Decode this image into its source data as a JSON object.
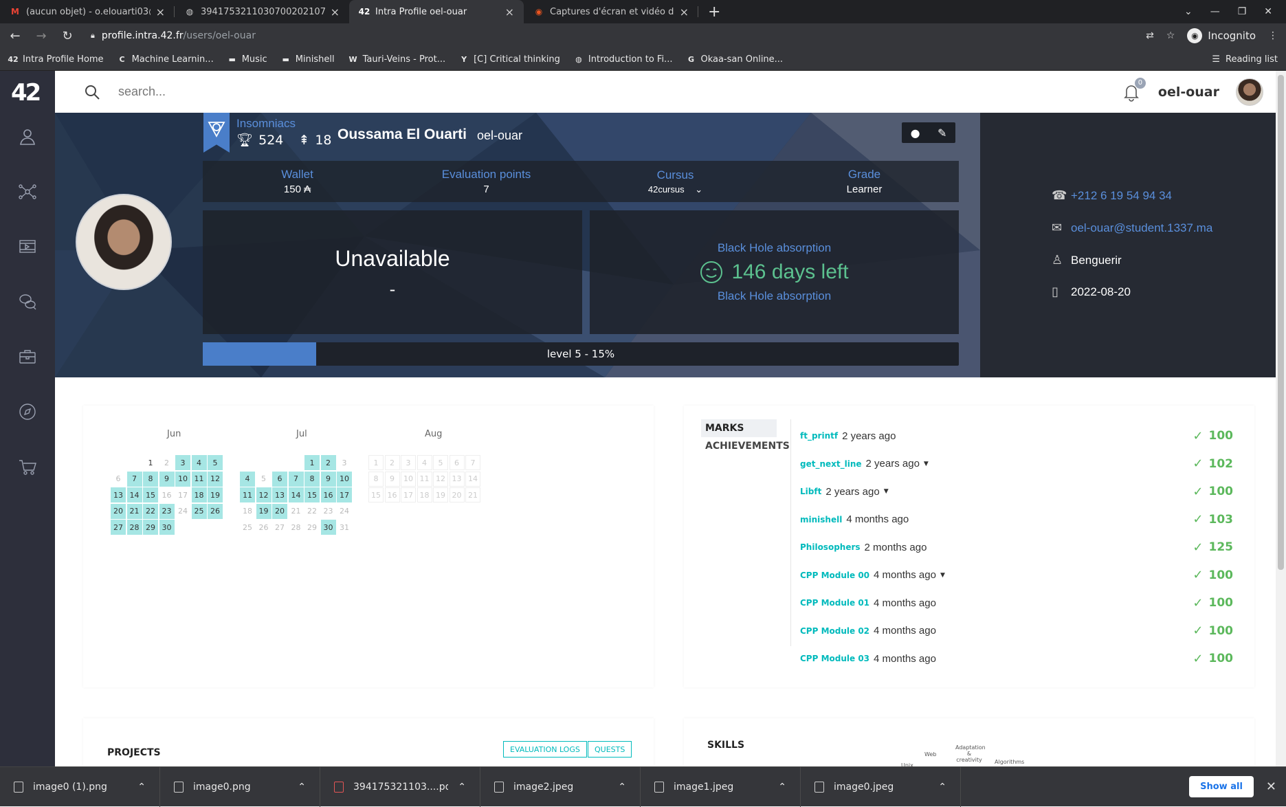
{
  "browser": {
    "tabs": [
      {
        "title": "(aucun objet) - o.elouarti03@...",
        "icon": "gmail-icon",
        "color": "#ea4335"
      },
      {
        "title": "39417532110307002021​07.pdf",
        "icon": "globe-icon",
        "color": "#ccc"
      },
      {
        "title": "Intra Profile oel-ouar",
        "icon": "42-icon",
        "color": "#fff"
      },
      {
        "title": "Captures d'écran et vidéo d'é...",
        "icon": "ubuntu-icon",
        "color": "#e95420"
      }
    ],
    "url_host": "profile.intra.42.fr",
    "url_path": "/users/oel-ouar",
    "incognito_label": "Incognito",
    "bookmarks": [
      {
        "label": "Intra Profile Home",
        "icon": "42-icon"
      },
      {
        "label": "Machine Learnin...",
        "icon": "coursera-icon"
      },
      {
        "label": "Music",
        "icon": "folder-icon"
      },
      {
        "label": "Minishell",
        "icon": "folder-icon"
      },
      {
        "label": "Tauri-Veins - Prot...",
        "icon": "w-icon"
      },
      {
        "label": "[C] Critical thinking",
        "icon": "y-icon"
      },
      {
        "label": "Introduction to Fi...",
        "icon": "globe-icon"
      },
      {
        "label": "Okaa-san Online...",
        "icon": "google-icon"
      }
    ],
    "reading_list": "Reading list"
  },
  "topbar": {
    "search_placeholder": "search...",
    "notification_count": "0",
    "username": "oel-ouar"
  },
  "profile": {
    "coalition": "Insomniacs",
    "trophies": "524",
    "rank_points": "18",
    "full_name": "Oussama El Ouarti",
    "login": "oel-ouar",
    "wallet_label": "Wallet",
    "wallet_value": "150 ₳",
    "eval_label": "Evaluation points",
    "eval_value": "7",
    "cursus_label": "Cursus",
    "cursus_value": "42cursus",
    "grade_label": "Grade",
    "grade_value": "Learner",
    "location_status": "Unavailable",
    "location_detail": "-",
    "blackhole_label": "Black Hole absorption",
    "blackhole_days": "146 days left",
    "level_text": "level 5 - 15%",
    "level_fraction": 0.15,
    "phone": "+212 6 19 54 94 34",
    "email": "oel-ouar@student.1337.ma",
    "city": "Benguerir",
    "date": "2022-08-20"
  },
  "calendar": {
    "months": [
      "Jun",
      "Jul",
      "Aug"
    ]
  },
  "marks": {
    "tabs": [
      "MARKS",
      "ACHIEVEMENTS"
    ],
    "items": [
      {
        "project": "ft_printf",
        "time": "2 years ago",
        "score": "100",
        "caret": false
      },
      {
        "project": "get_next_line",
        "time": "2 years ago",
        "score": "102",
        "caret": true
      },
      {
        "project": "Libft",
        "time": "2 years ago",
        "score": "100",
        "caret": true
      },
      {
        "project": "minishell",
        "time": "4 months ago",
        "score": "103",
        "caret": false
      },
      {
        "project": "Philosophers",
        "time": "2 months ago",
        "score": "125",
        "caret": false
      },
      {
        "project": "CPP Module 00",
        "time": "4 months ago",
        "score": "100",
        "caret": true
      },
      {
        "project": "CPP Module 01",
        "time": "4 months ago",
        "score": "100",
        "caret": false
      },
      {
        "project": "CPP Module 02",
        "time": "4 months ago",
        "score": "100",
        "caret": false
      },
      {
        "project": "CPP Module 03",
        "time": "4 months ago",
        "score": "100",
        "caret": false
      }
    ]
  },
  "projects": {
    "title": "PROJECTS",
    "eval_logs": "EVALUATION LOGS",
    "quests": "QUESTS"
  },
  "skills": {
    "title": "SKILLS",
    "labels": [
      "Web",
      "Adaptation & creativity",
      "Algorithms",
      "Unix"
    ]
  },
  "downloads": {
    "items": [
      "image0 (1).png",
      "image0.png",
      "394175321103....pdf",
      "image2.jpeg",
      "image1.jpeg",
      "image0.jpeg"
    ],
    "show_all": "Show all"
  }
}
